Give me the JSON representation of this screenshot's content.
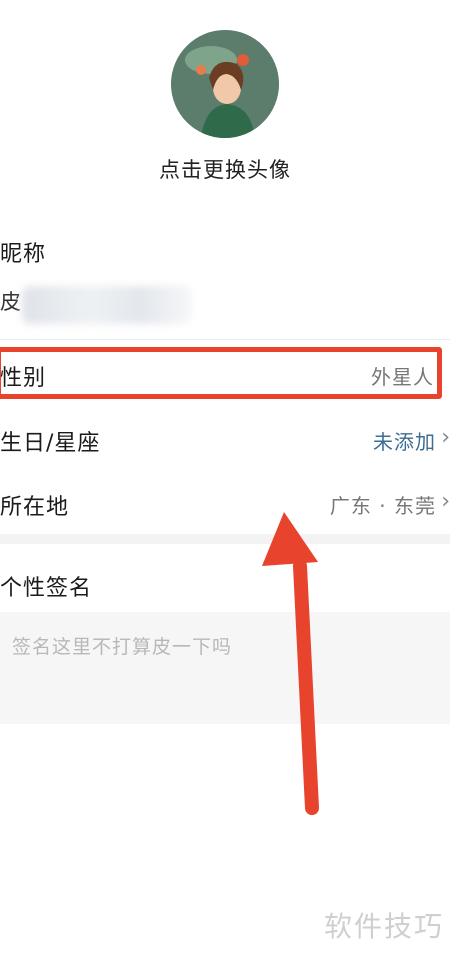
{
  "profile": {
    "change_avatar": "点击更换头像",
    "nickname_label": "昵称",
    "nickname_visible": "皮",
    "gender_label": "性别",
    "gender_value": "外星人",
    "birthday_label": "生日/星座",
    "birthday_value": "未添加",
    "location_label": "所在地",
    "location_value": "广东 · 东莞",
    "signature_label": "个性签名",
    "signature_placeholder": "签名这里不打算皮一下吗"
  },
  "icons": {
    "chevron": "chevron-right-icon",
    "avatar": "avatar-image",
    "annotation_arrow": "annotation-arrow"
  },
  "colors": {
    "highlight": "#e8432c",
    "link": "#3d6d92",
    "placeholder": "#b8b8b8"
  },
  "watermark": "软件技巧"
}
